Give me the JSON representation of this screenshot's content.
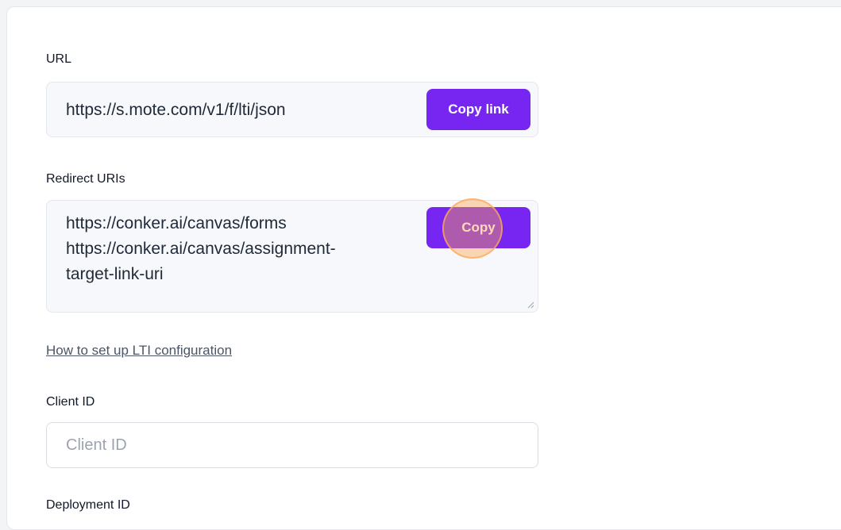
{
  "url_section": {
    "label": "URL",
    "value": "https://s.mote.com/v1/f/lti/json",
    "button_label": "Copy link"
  },
  "redirect_section": {
    "label": "Redirect URIs",
    "lines": [
      "https://conker.ai/canvas/forms",
      "https://conker.ai/canvas/assignment-",
      "target-link-uri"
    ],
    "button_label": "Copy"
  },
  "help_link": "How to set up LTI configuration",
  "client_id": {
    "label": "Client ID",
    "placeholder": "Client ID",
    "value": ""
  },
  "deployment_id": {
    "label": "Deployment ID"
  },
  "colors": {
    "accent": "#7626f0",
    "click_indicator": "#ffa550"
  }
}
